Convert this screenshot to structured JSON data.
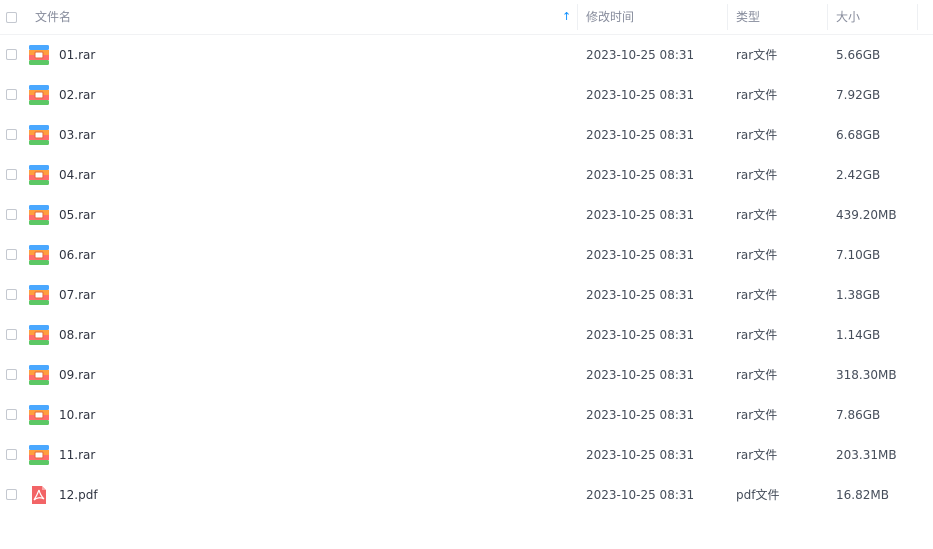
{
  "header": {
    "name": "文件名",
    "modified": "修改时间",
    "type": "类型",
    "size": "大小",
    "sort_indicator": "↑"
  },
  "colors": {
    "sort_arrow": "#0d8fff",
    "header_text": "#878c9c",
    "row_text": "#454d5a"
  },
  "files": [
    {
      "name": "01.rar",
      "modified": "2023-10-25 08:31",
      "type": "rar文件",
      "size": "5.66GB",
      "icon": "rar-archive-icon"
    },
    {
      "name": "02.rar",
      "modified": "2023-10-25 08:31",
      "type": "rar文件",
      "size": "7.92GB",
      "icon": "rar-archive-icon"
    },
    {
      "name": "03.rar",
      "modified": "2023-10-25 08:31",
      "type": "rar文件",
      "size": "6.68GB",
      "icon": "rar-archive-icon"
    },
    {
      "name": "04.rar",
      "modified": "2023-10-25 08:31",
      "type": "rar文件",
      "size": "2.42GB",
      "icon": "rar-archive-icon"
    },
    {
      "name": "05.rar",
      "modified": "2023-10-25 08:31",
      "type": "rar文件",
      "size": "439.20MB",
      "icon": "rar-archive-icon"
    },
    {
      "name": "06.rar",
      "modified": "2023-10-25 08:31",
      "type": "rar文件",
      "size": "7.10GB",
      "icon": "rar-archive-icon"
    },
    {
      "name": "07.rar",
      "modified": "2023-10-25 08:31",
      "type": "rar文件",
      "size": "1.38GB",
      "icon": "rar-archive-icon"
    },
    {
      "name": "08.rar",
      "modified": "2023-10-25 08:31",
      "type": "rar文件",
      "size": "1.14GB",
      "icon": "rar-archive-icon"
    },
    {
      "name": "09.rar",
      "modified": "2023-10-25 08:31",
      "type": "rar文件",
      "size": "318.30MB",
      "icon": "rar-archive-icon"
    },
    {
      "name": "10.rar",
      "modified": "2023-10-25 08:31",
      "type": "rar文件",
      "size": "7.86GB",
      "icon": "rar-archive-icon"
    },
    {
      "name": "11.rar",
      "modified": "2023-10-25 08:31",
      "type": "rar文件",
      "size": "203.31MB",
      "icon": "rar-archive-icon"
    },
    {
      "name": "12.pdf",
      "modified": "2023-10-25 08:31",
      "type": "pdf文件",
      "size": "16.82MB",
      "icon": "pdf-file-icon"
    }
  ]
}
